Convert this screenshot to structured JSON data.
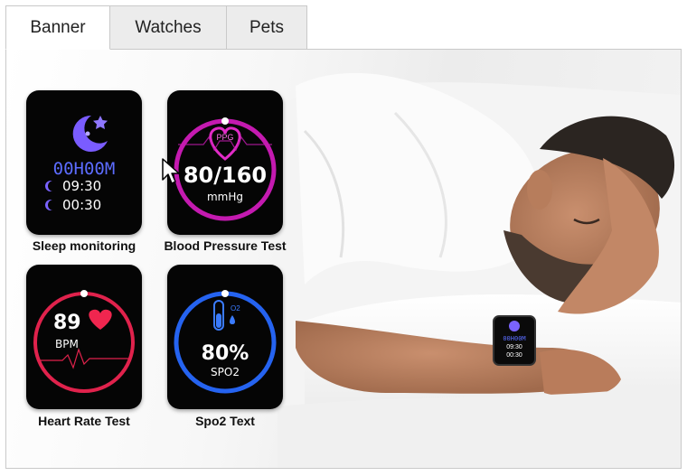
{
  "tabs": [
    {
      "label": "Banner",
      "active": true
    },
    {
      "label": "Watches",
      "active": false
    },
    {
      "label": "Pets",
      "active": false
    }
  ],
  "cards": {
    "sleep": {
      "label": "Sleep monitoring",
      "duration": "00H00M",
      "bed_time": "09:30",
      "wake_time": "00:30",
      "accent": "#6a57f5"
    },
    "blood_pressure": {
      "label": "Blood Pressure Test",
      "badge": "PPG",
      "reading": "80/160",
      "unit": "mmHg",
      "accent": "#d81bb8"
    },
    "heart_rate": {
      "label": "Heart Rate Test",
      "value": "89",
      "unit": "BPM",
      "accent": "#e8264f"
    },
    "spo2": {
      "label": "Spo2 Text",
      "badge": "O2",
      "value": "80%",
      "unit": "SPO2",
      "accent": "#2a6df5"
    }
  },
  "wrist_watch": {
    "duration": "00H00M",
    "bed_time": "09:30",
    "wake_time": "00:30"
  },
  "icons": [
    "moon-stars-icon",
    "heart-icon",
    "crescent-icon",
    "test-tube-icon",
    "droplet-icon",
    "mouse-cursor-icon"
  ]
}
